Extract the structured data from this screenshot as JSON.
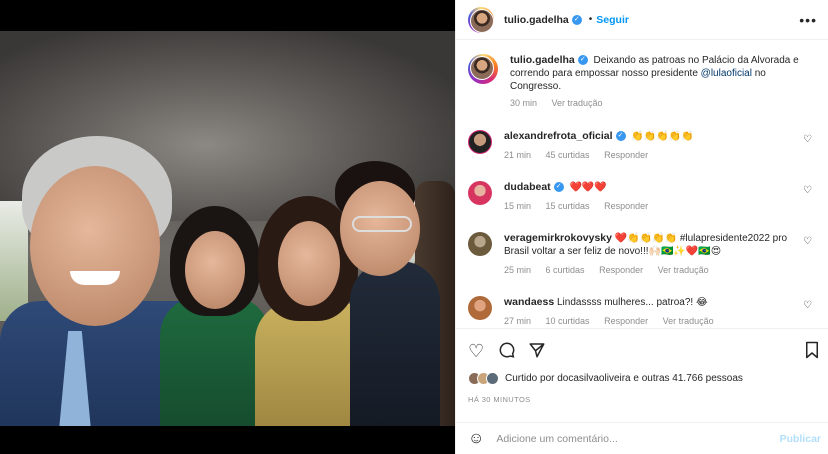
{
  "post": {
    "author": "tulio.gadelha",
    "follow_label": "Seguir",
    "separator": "•",
    "more_label": "•••",
    "caption": "Deixando as patroas no Palácio da Alvorada e correndo para empossar nosso presidente",
    "caption_mention": "@lulaoficial",
    "caption_tail": " no Congresso.",
    "caption_time": "30 min",
    "caption_translate": "Ver tradução"
  },
  "comments": [
    {
      "user": "alexandrefrota_oficial",
      "verified": true,
      "text": "👏👏👏👏👏",
      "time": "21 min",
      "likes": "45 curtidas",
      "reply": "Responder"
    },
    {
      "user": "dudabeat",
      "verified": true,
      "text": "❤️❤️❤️",
      "time": "15 min",
      "likes": "15 curtidas",
      "reply": "Responder"
    },
    {
      "user": "veragemirkrokovysky",
      "verified": false,
      "text": "❤️👏👏👏👏 #lulapresidente2022 pro Brasil voltar a ser feliz de novo!!!🙌🏻🇧🇷✨❤️🇧🇷😍",
      "time": "25 min",
      "likes": "6 curtidas",
      "reply": "Responder",
      "translate": "Ver tradução"
    },
    {
      "user": "wandaess",
      "verified": false,
      "text": "Lindassss mulheres... patroa?! 😂",
      "time": "27 min",
      "likes": "10 curtidas",
      "reply": "Responder",
      "translate": "Ver tradução"
    }
  ],
  "likes_text": "Curtido por docasilvaoliveira e outras 41.766 pessoas",
  "timestamp": "HÁ 30 MINUTOS",
  "add_comment": {
    "placeholder": "Adicione um comentário...",
    "publish": "Publicar"
  },
  "icons": [
    "heart-icon",
    "comment-icon",
    "share-icon",
    "bookmark-icon",
    "emoji-icon",
    "verified-icon",
    "more-icon"
  ],
  "colors": {
    "link": "#0095f6",
    "verified": "#3897f0",
    "muted": "#8e8e8e",
    "mention": "#00376b"
  }
}
